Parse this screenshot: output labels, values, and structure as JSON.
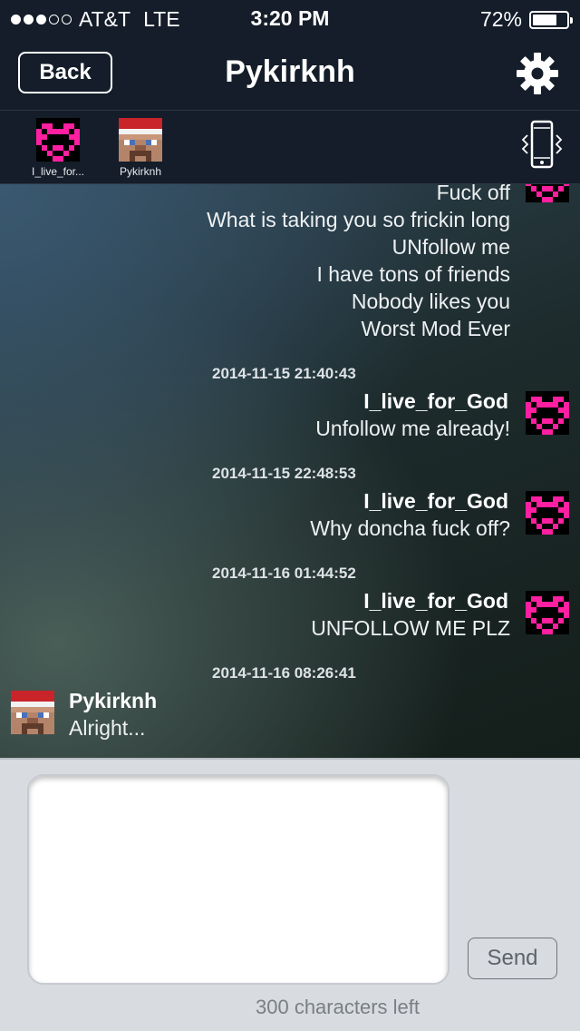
{
  "status_bar": {
    "carrier": "AT&T",
    "network": "LTE",
    "time": "3:20 PM",
    "battery_text": "72%",
    "battery_level": 0.72,
    "signal_bars": 3,
    "signal_total": 5
  },
  "nav": {
    "back_label": "Back",
    "title": "Pykirknh",
    "settings_icon": "gear-icon"
  },
  "participants": [
    {
      "name": "I_live_for...",
      "avatar": "pink-heart-avatar"
    },
    {
      "name": "Pykirknh",
      "avatar": "santa-hat-steve-avatar"
    }
  ],
  "vibrate_icon": "phone-vibrate-icon",
  "chat": {
    "partial_lines": [
      "Fuck off",
      "What is taking you so frickin long",
      "UNfollow me",
      "I have tons of friends",
      "Nobody likes you",
      "Worst Mod Ever"
    ],
    "messages": [
      {
        "timestamp": "2014-11-15 21:40:43",
        "sender": "I_live_for_God",
        "text": "Unfollow me already!"
      },
      {
        "timestamp": "2014-11-15 22:48:53",
        "sender": "I_live_for_God",
        "text": "Why doncha fuck off?"
      },
      {
        "timestamp": "2014-11-16 01:44:52",
        "sender": "I_live_for_God",
        "text": "UNFOLLOW ME PLZ"
      },
      {
        "timestamp": "2014-11-16 08:26:41",
        "sender": "Pykirknh",
        "text": "Alright..."
      }
    ]
  },
  "compose": {
    "message_value": "",
    "send_label": "Send",
    "char_count": "300 characters left"
  },
  "colors": {
    "heart_pink": "#ff1fa0",
    "hat_red": "#c8242a",
    "bar_bg": "#141d29"
  }
}
